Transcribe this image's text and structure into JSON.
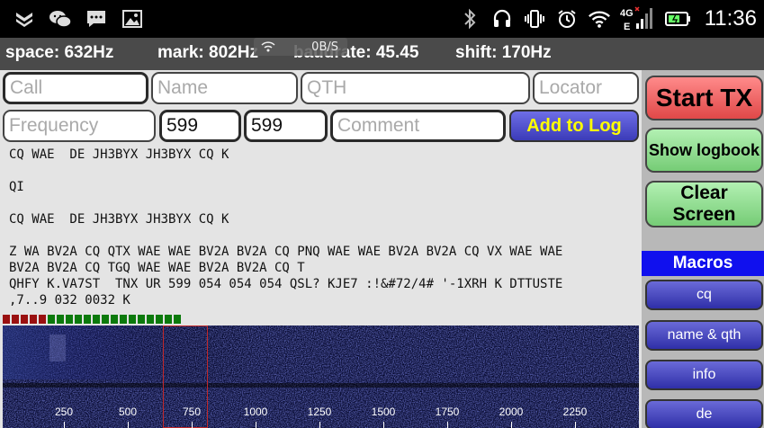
{
  "statusbar": {
    "time": "11:36",
    "left_icons": [
      "shield-icon",
      "wechat-icon",
      "message-icon",
      "image-icon"
    ],
    "right_icons": [
      "bluetooth-icon",
      "headset-icon",
      "vibrate-icon",
      "alarm-icon",
      "wifi-icon",
      "mobile-signal-icon",
      "battery-icon"
    ],
    "network_type": "4G",
    "network_sub": "E",
    "netspeed": "0B/S"
  },
  "info": {
    "space": "space: 632Hz",
    "mark": "mark: 802Hz",
    "baudrate": "baudrate: 45.45",
    "shift": "shift: 170Hz"
  },
  "form": {
    "call_placeholder": "Call",
    "name_placeholder": "Name",
    "qth_placeholder": "QTH",
    "locator_placeholder": "Locator",
    "frequency_placeholder": "Frequency",
    "rst_sent": "599",
    "rst_rcvd": "599",
    "comment_placeholder": "Comment",
    "add_to_log": "Add to Log"
  },
  "rx_text": "CQ WAE  DE JH3BYX JH3BYX CQ K\n\nQI\n\nCQ WAE  DE JH3BYX JH3BYX CQ K\n\nZ WA BV2A CQ QTX WAE WAE BV2A BV2A CQ PNQ WAE WAE BV2A BV2A CQ VX WAE WAE\nBV2A BV2A CQ TGQ WAE WAE BV2A BV2A CQ T\nQHFY K.VA7ST  TNX UR 599 054 054 054 QSL? KJE7 :!&#72/4# '-1XRH K DTTUSTE\n,7..9 032 0032 K",
  "level_meter": {
    "segments": [
      "#9a1010",
      "#9a1010",
      "#9a1010",
      "#9a1010",
      "#9a1010",
      "#0c7a0c",
      "#0c7a0c",
      "#0c7a0c",
      "#0c7a0c",
      "#0c7a0c",
      "#0c7a0c",
      "#0c7a0c",
      "#0c7a0c",
      "#0c7a0c",
      "#0c7a0c",
      "#0c7a0c",
      "#0c7a0c",
      "#0c7a0c",
      "#0c7a0c",
      "#0c7a0c"
    ]
  },
  "waterfall": {
    "ticks": [
      "250",
      "500",
      "750",
      "1000",
      "1250",
      "1500",
      "1750",
      "2000",
      "2250"
    ]
  },
  "side": {
    "start_tx": "Start TX",
    "show_logbook": "Show logbook",
    "clear_screen": "Clear Screen",
    "macros_header": "Macros",
    "macros": [
      "cq",
      "name & qth",
      "info",
      "de"
    ]
  },
  "colors": {
    "start_tx": "#e04848",
    "green_button": "#76cc76",
    "macro_button": "#2f2fa8",
    "macros_header": "#1010ee",
    "add_to_log_text": "#ffff00"
  }
}
